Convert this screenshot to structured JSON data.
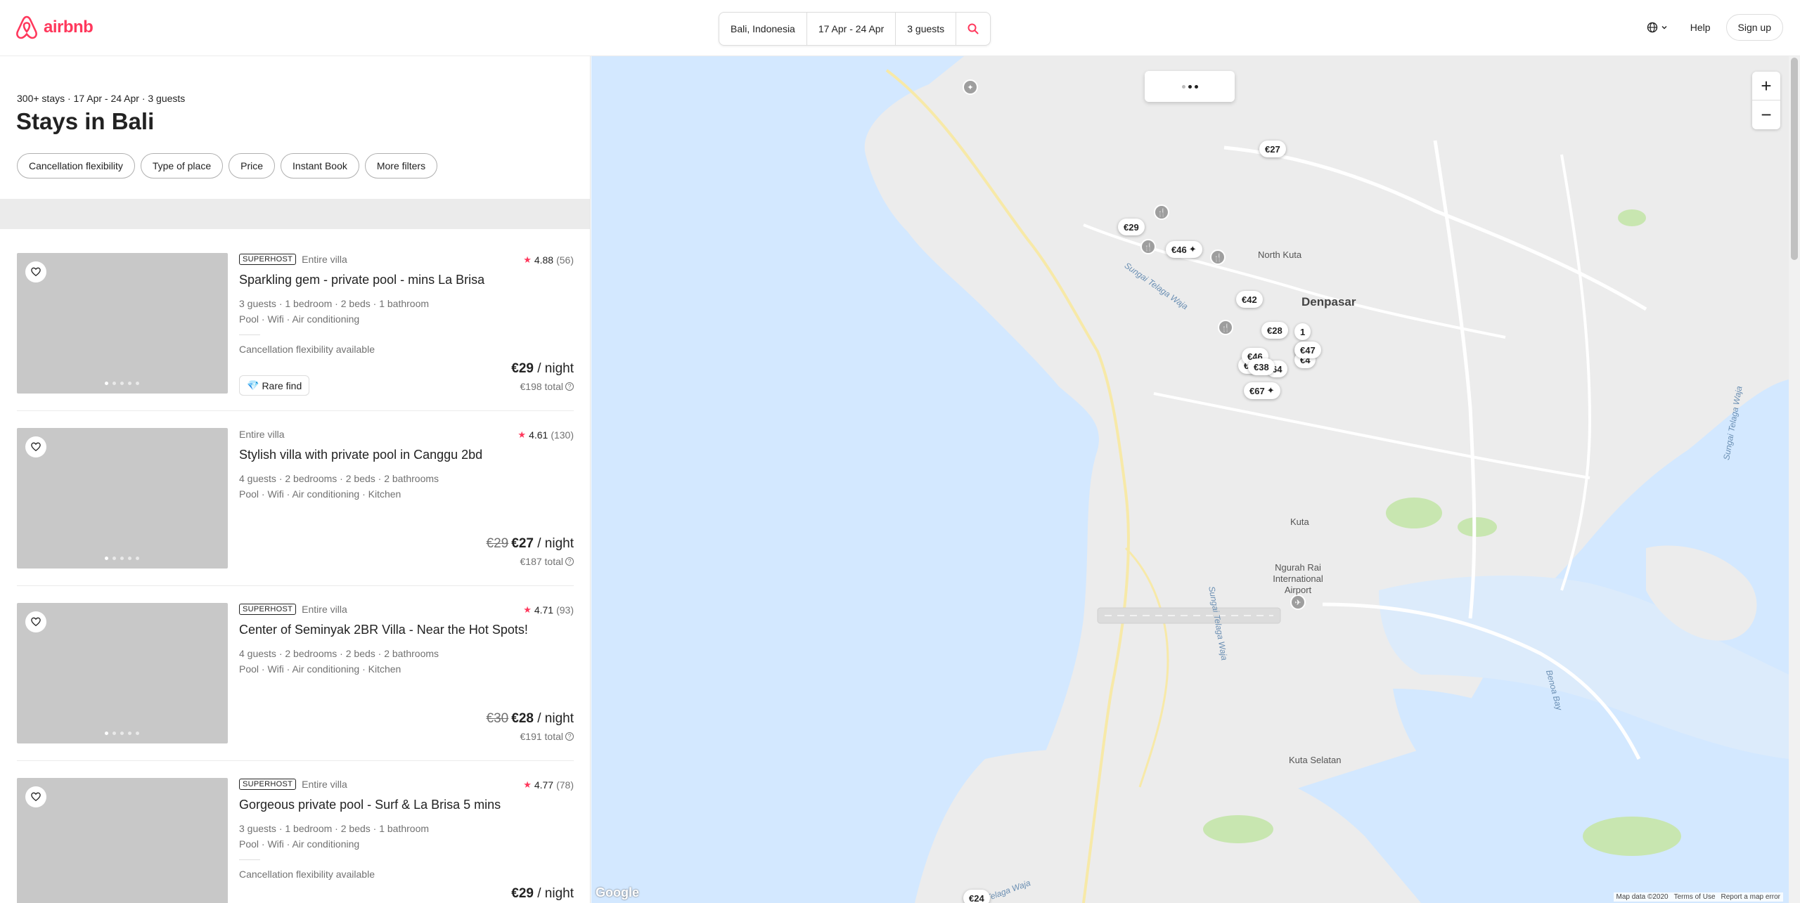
{
  "header": {
    "logo_text": "airbnb",
    "search": {
      "location": "Bali, Indonesia",
      "dates": "17 Apr - 24 Apr",
      "guests": "3 guests"
    },
    "help": "Help",
    "signup": "Sign up",
    "colors": {
      "brand": "#ff385c"
    }
  },
  "results": {
    "summary": "300+ stays · 17 Apr - 24 Apr · 3 guests",
    "title": "Stays in Bali",
    "filters": [
      "Cancellation flexibility",
      "Type of place",
      "Price",
      "Instant Book",
      "More filters"
    ]
  },
  "listings": [
    {
      "superhost": "SUPERHOST",
      "type": "Entire villa",
      "rating": "4.88",
      "reviews": "(56)",
      "title": "Sparkling gem - private pool - mins La Brisa",
      "details": "3 guests · 1 bedroom · 2 beds · 1 bathroom",
      "amenities": "Pool · Wifi · Air conditioning",
      "cancellation": "Cancellation flexibility available",
      "badge": "Rare find",
      "old_price": "",
      "price": "€29",
      "per": " / night",
      "total": "€198 total"
    },
    {
      "superhost": "",
      "type": "Entire villa",
      "rating": "4.61",
      "reviews": "(130)",
      "title": "Stylish villa with private pool in Canggu 2bd",
      "details": "4 guests · 2 bedrooms · 2 beds · 2 bathrooms",
      "amenities": "Pool · Wifi · Air conditioning · Kitchen",
      "cancellation": "",
      "badge": "",
      "old_price": "€29",
      "price": "€27",
      "per": " / night",
      "total": "€187 total"
    },
    {
      "superhost": "SUPERHOST",
      "type": "Entire villa",
      "rating": "4.71",
      "reviews": "(93)",
      "title": "Center of Seminyak 2BR Villa - Near the Hot Spots!",
      "details": "4 guests · 2 bedrooms · 2 beds · 2 bathrooms",
      "amenities": "Pool · Wifi · Air conditioning · Kitchen",
      "cancellation": "",
      "badge": "",
      "old_price": "€30",
      "price": "€28",
      "per": " / night",
      "total": "€191 total"
    },
    {
      "superhost": "SUPERHOST",
      "type": "Entire villa",
      "rating": "4.77",
      "reviews": "(78)",
      "title": "Gorgeous private pool - Surf & La Brisa 5 mins",
      "details": "3 guests · 1 bedroom · 2 beds · 1 bathroom",
      "amenities": "Pool · Wifi · Air conditioning",
      "cancellation": "Cancellation flexibility available",
      "badge": "",
      "old_price": "",
      "price": "€29",
      "per": " / night",
      "total": ""
    }
  ],
  "map": {
    "pins": [
      "€27",
      "€29",
      "€46",
      "€42",
      "€28",
      "€47",
      "€38",
      "€67",
      "€24",
      "€4",
      "€46",
      "64",
      "56",
      "1",
      "€4"
    ],
    "labels": {
      "denpasar": "Denpasar",
      "north_kuta": "North Kuta",
      "kuta": "Kuta",
      "airport": "Ngurah Rai International Airport",
      "kuta_selatan": "Kuta Selatan",
      "sungai1": "Sungai Telaga Waja",
      "sungai2": "Sungai Telaga Waja",
      "sungai3": "Telaga Waja",
      "benoa_bay": "Benoa Bay",
      "sungai4": "Sungai Telaga Waja"
    },
    "google": "Google",
    "footer": [
      "Map data ©2020",
      "Terms of Use",
      "Report a map error"
    ],
    "colors": {
      "water": "#d3e8ff",
      "land": "#ececec",
      "park": "#c8e6b0"
    }
  }
}
